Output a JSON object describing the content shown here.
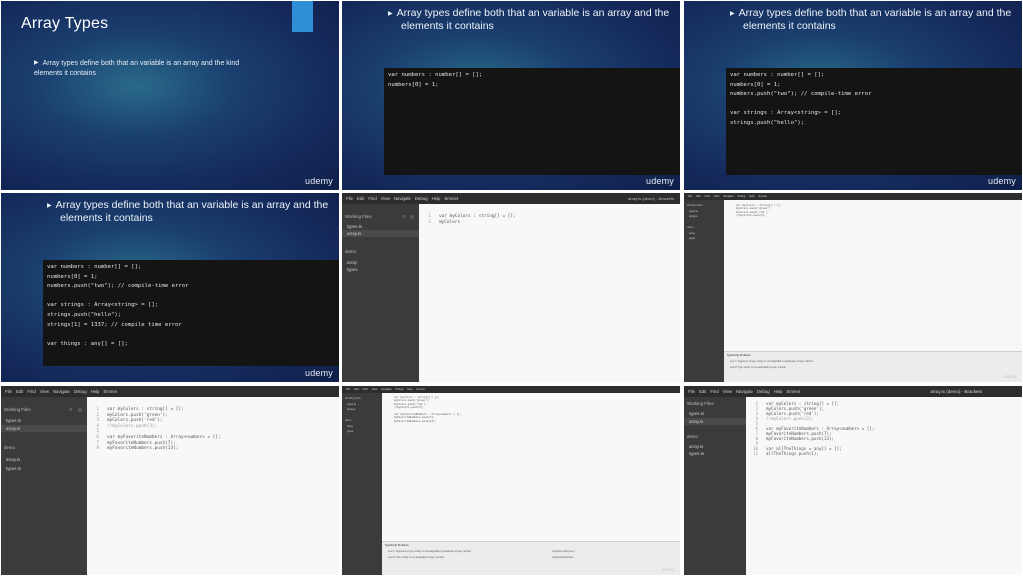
{
  "slide": {
    "title": "Array Types",
    "bullet_line1": "Array types define both that an variable is an array and the kind",
    "bullet_line2": "elements it contains",
    "big_line1": "Array types define both that an variable is an array and the",
    "big_line2": "elements it contains",
    "brand": "udemy",
    "accent_color": "#2e8fd6"
  },
  "code": {
    "l1": "var numbers : number[] = [];",
    "l2": "numbers[0] = 1;",
    "l3": "numbers.push(\"two\"); // compile-time error",
    "l4": "var strings : Array<string> = [];",
    "l5": "strings.push(\"hello\");",
    "l6": "strings[1] = 1337; // compile time error",
    "l7": "var things : any[] = [];"
  },
  "editor": {
    "menu": [
      "File",
      "Edit",
      "Find",
      "View",
      "Navigate",
      "Debug",
      "Help",
      "Emmet"
    ],
    "window_title": "array.ts (demo) - Brackets",
    "working_files": "Working Files",
    "demo": "demo",
    "file_types": "types.ts",
    "file_array": "array.ts",
    "file_array_short": "array",
    "file_types_short": "types",
    "brand": "udemy",
    "code_v1": {
      "l1": "var myColors : string[] = [];",
      "l2": "myColors"
    },
    "code_v2": {
      "l1": "var myColors : string[] = [];",
      "l2": "myColors.push('green');",
      "l3": "myColors.push('red');",
      "l4": "//myColors.push(3);",
      "l6": "var myFavoriteNumbers : Array<number> = [];",
      "l7": "myFavoriteNumbers.push(7);",
      "l8": "myFavoriteNumbers.push(13);"
    },
    "code_v3": {
      "l9": "var allTheThings = any[] = [];",
      "l10": "allTheThings.push(1);"
    },
    "problems": {
      "header": "TypeScript Problems",
      "p1": "Line 7: Argument of type 'string' is not assignable to parameter of type 'number'",
      "p2": "Line 8: Type 'string' is not assignable to type 'number'",
      "p1_loc": "myColors.push('one');",
      "p2_loc": "myFavoriteNumbers"
    },
    "status": "Line 8, Column 30 — 10 Lines"
  }
}
